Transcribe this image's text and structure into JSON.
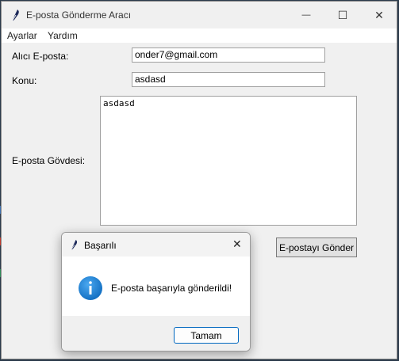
{
  "window": {
    "title": "E-posta Gönderme Aracı",
    "minimize_glyph": "—",
    "maximize_glyph": "☐",
    "close_glyph": "✕"
  },
  "menu": {
    "items": [
      "Ayarlar",
      "Yardım"
    ]
  },
  "form": {
    "recipient_label": "Alıcı E-posta:",
    "recipient_value": "onder7@gmail.com",
    "subject_label": "Konu:",
    "subject_value": "asdasd",
    "body_label": "E-posta Gövdesi:",
    "body_value": "asdasd",
    "send_button": "E-postayı Gönder"
  },
  "dialog": {
    "title": "Başarılı",
    "close_glyph": "✕",
    "message": "E-posta başarıyla gönderildi!",
    "ok_button": "Tamam",
    "icon": "info-icon"
  },
  "colors": {
    "info_icon": "#1a7fd4",
    "ok_button_border": "#0067c0",
    "window_bg": "#f0f0f0"
  }
}
